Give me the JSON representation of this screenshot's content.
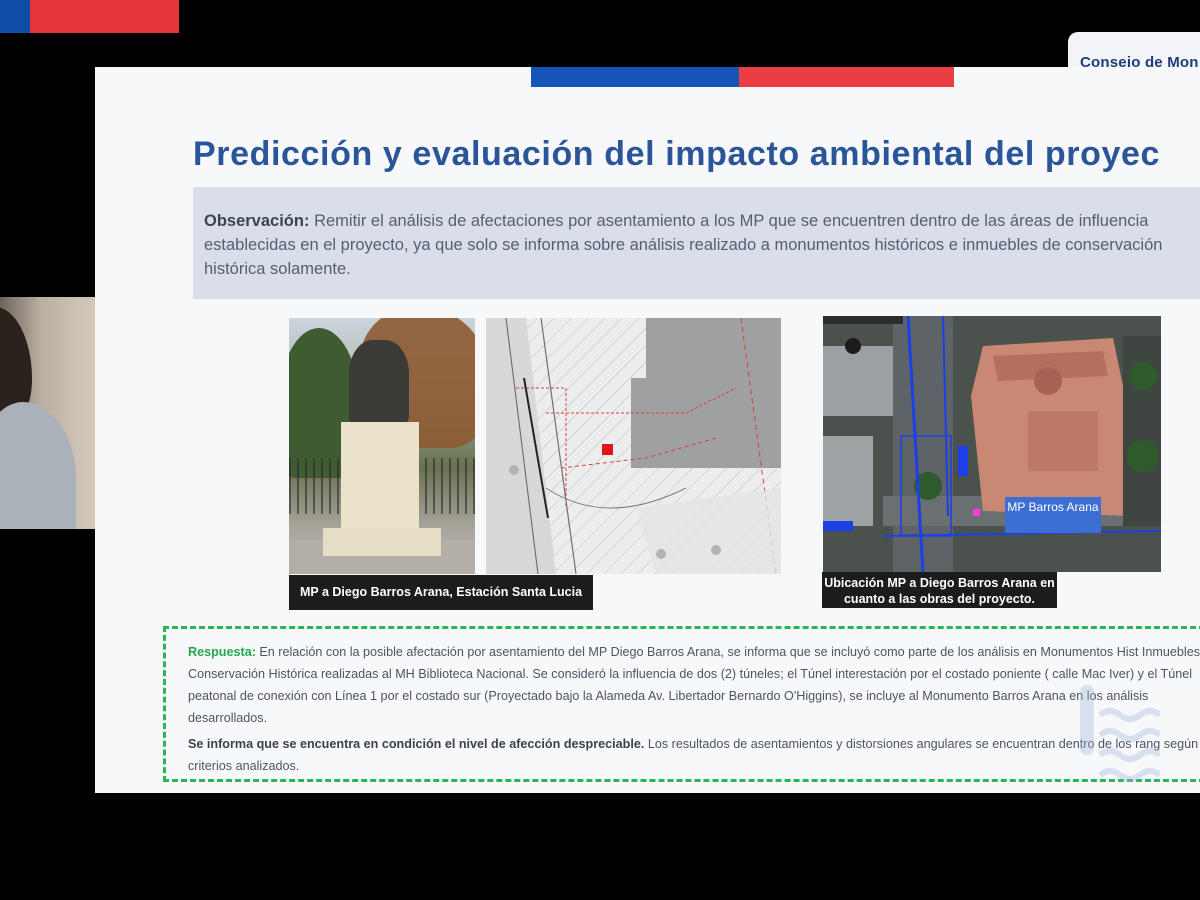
{
  "brand": {
    "org_name": "Consejo de Mon",
    "colors": {
      "flag_blue": "#1455b5",
      "flag_red": "#ea3d44",
      "title_blue": "#2a5599",
      "answer_green": "#26a84f"
    }
  },
  "slide": {
    "title": "Predicción y evaluación del impacto ambiental del proyec",
    "observation": {
      "label": "Observación:",
      "text": "Remitir el análisis de afectaciones por asentamiento a los MP que se encuentren dentro de las áreas de influencia establecidas en el proyecto, ya que solo se informa sobre análisis realizado a monumentos históricos e inmuebles de conservación histórica solamente."
    },
    "images": {
      "photo_caption": "MP a Diego Barros Arana, Estación Santa Lucia",
      "aerial_caption": "Ubicación MP a Diego Barros Arana en cuanto  a las obras del proyecto.",
      "aerial_label": "MP Barros Arana"
    },
    "response": {
      "label": "Respuesta:",
      "paragraph1": "En relación con la posible afectación por asentamiento del MP Diego Barros Arana, se informa que se incluyó como parte de los análisis en Monumentos Hist Inmuebles de Conservación Histórica realizadas al MH  Biblioteca Nacional.  Se consideró la influencia de dos (2) túneles; el Túnel interestación por el costado poniente ( calle Mac Iver) y el Túnel peatonal de conexión con Línea 1 por el costado sur (Proyectado bajo la Alameda Av. Libertador Bernardo O'Higgins), se incluye al Monumento Barros Arana en los análisis desarrollados.",
      "bold_sentence": "Se informa que se encuentra en condición el nivel de afección despreciable.",
      "paragraph2_rest": "Los resultados de asentamientos y distorsiones angulares se encuentran dentro de los rang según los criterios analizados."
    }
  }
}
